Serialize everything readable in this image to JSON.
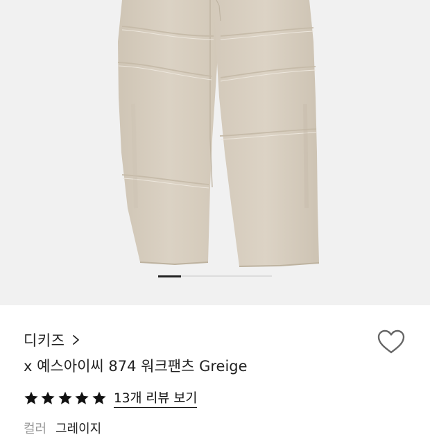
{
  "product_image": {
    "alt": "x 예스아이씨 874 워크팬츠 Greige",
    "bg_color": "#f1f1f1",
    "fabric_color": "#d8cfc0",
    "pager": {
      "count": 5,
      "active_index": 0
    }
  },
  "brand": {
    "name": "디키즈",
    "chevron": "chevron-right-icon"
  },
  "wishlist": {
    "icon": "heart-outline-icon"
  },
  "product": {
    "title": "x 예스아이씨 874 워크팬츠 Greige"
  },
  "rating": {
    "stars": 5,
    "max_stars": 5,
    "star_color": "#111111",
    "review_link": "13개 리뷰 보기"
  },
  "option": {
    "label": "컬러",
    "value": "그레이지"
  }
}
